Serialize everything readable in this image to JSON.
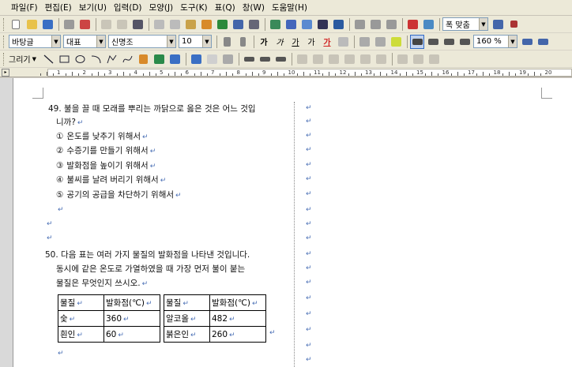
{
  "menu": [
    "파일(F)",
    "편집(E)",
    "보기(U)",
    "입력(D)",
    "모양(J)",
    "도구(K)",
    "표(Q)",
    "창(W)",
    "도움말(H)"
  ],
  "format_bar": {
    "style": "바탕글",
    "lang": "대표",
    "font": "신명조",
    "size": "10",
    "bold": "가",
    "italic": "가",
    "underline": "가",
    "strike": "가",
    "color": "가",
    "line_spacing": "160 %"
  },
  "zoom": "폭 맞춤",
  "draw_label": "그리기",
  "ruler_numbers": [
    "1",
    "2",
    "3",
    "4",
    "5",
    "6",
    "7",
    "8",
    "9",
    "10",
    "11",
    "12",
    "13",
    "14",
    "15",
    "16",
    "17",
    "18",
    "19",
    "20"
  ],
  "para_mark": "↵",
  "q49": {
    "line1": "49. 불을 끌 때 모래를 뿌리는 까닭으로 옳은 것은 어느 것입",
    "line2": "니까?",
    "options": [
      {
        "num": "①",
        "text": "온도를 낮추기 위해서"
      },
      {
        "num": "②",
        "text": "수증기를 만들기 위해서"
      },
      {
        "num": "③",
        "text": "발화점을 높이기 위해서"
      },
      {
        "num": "④",
        "text": "불씨를 날려 버리기 위해서"
      },
      {
        "num": "⑤",
        "text": "공기의 공급을 차단하기 위해서"
      }
    ]
  },
  "q50": {
    "line1": "50. 다음 표는 여러 가지 물질의 발화점을 나타낸 것입니다.",
    "line2": "동시에 같은 온도로 가열하였을 때 가장 먼저 불이 붙는",
    "line3": "물질은 무엇인지 쓰시오.",
    "table_left": {
      "headers": [
        "물질",
        "발화점(℃)"
      ],
      "rows": [
        [
          "숯",
          "360"
        ],
        [
          "흰인",
          "60"
        ]
      ]
    },
    "table_right": {
      "headers": [
        "물질",
        "발화점(℃)"
      ],
      "rows": [
        [
          "알코올",
          "482"
        ],
        [
          "붉은인",
          "260"
        ]
      ]
    }
  }
}
